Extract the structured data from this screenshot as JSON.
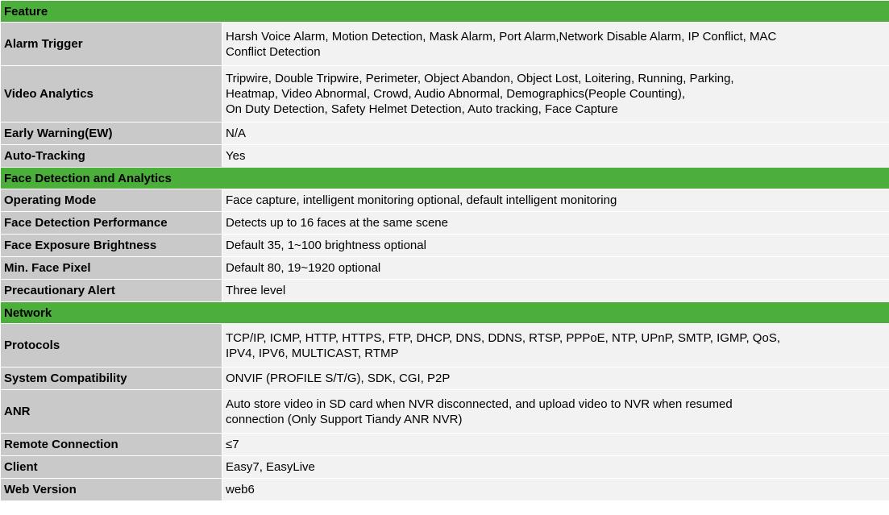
{
  "sections": [
    {
      "title": "Feature",
      "rows": [
        {
          "key": "Alarm Trigger",
          "value": [
            "Harsh Voice Alarm, Motion Detection, Mask Alarm, Port Alarm,Network Disable Alarm, IP Conflict, MAC",
            "Conflict Detection"
          ]
        },
        {
          "key": "Video Analytics",
          "value": [
            "Tripwire, Double Tripwire, Perimeter, Object  Abandon, Object Lost, Loitering, Running, Parking,",
            "Heatmap, Video Abnormal, Crowd, Audio Abnormal, Demographics(People Counting),",
            "On Duty Detection, Safety Helmet Detection, Auto tracking, Face Capture"
          ]
        },
        {
          "key": "Early Warning(EW)",
          "value": [
            "N/A"
          ]
        },
        {
          "key": "Auto-Tracking",
          "value": [
            "Yes"
          ]
        }
      ]
    },
    {
      "title": "Face Detection and Analytics",
      "rows": [
        {
          "key": "Operating Mode",
          "value": [
            "Face capture, intelligent monitoring optional, default intelligent monitoring"
          ]
        },
        {
          "key": "Face Detection Performance",
          "value": [
            "Detects up to 16 faces at the same scene"
          ]
        },
        {
          "key": "Face Exposure Brightness",
          "value": [
            "Default 35, 1~100 brightness optional"
          ]
        },
        {
          "key": "Min. Face Pixel",
          "value": [
            "Default 80, 19~1920 optional"
          ]
        },
        {
          "key": "Precautionary Alert",
          "value": [
            "Three level"
          ]
        }
      ]
    },
    {
      "title": "Network",
      "rows": [
        {
          "key": "Protocols",
          "value": [
            "TCP/IP, ICMP, HTTP, HTTPS, FTP, DHCP, DNS, DDNS, RTSP, PPPoE, NTP, UPnP, SMTP,  IGMP, QoS,",
            "IPV4, IPV6, MULTICAST, RTMP"
          ]
        },
        {
          "key": "System Compatibility",
          "value": [
            "ONVIF (PROFILE S/T/G), SDK, CGI, P2P"
          ]
        },
        {
          "key": "ANR",
          "value": [
            "Auto store video in SD card when NVR disconnected, and upload video to NVR when resumed",
            "connection (Only Support Tiandy ANR NVR)"
          ]
        },
        {
          "key": "Remote Connection",
          "value": [
            "≤7"
          ]
        },
        {
          "key": "Client",
          "value": [
            "Easy7, EasyLive"
          ]
        },
        {
          "key": "Web Version",
          "value": [
            "web6"
          ]
        }
      ]
    }
  ]
}
